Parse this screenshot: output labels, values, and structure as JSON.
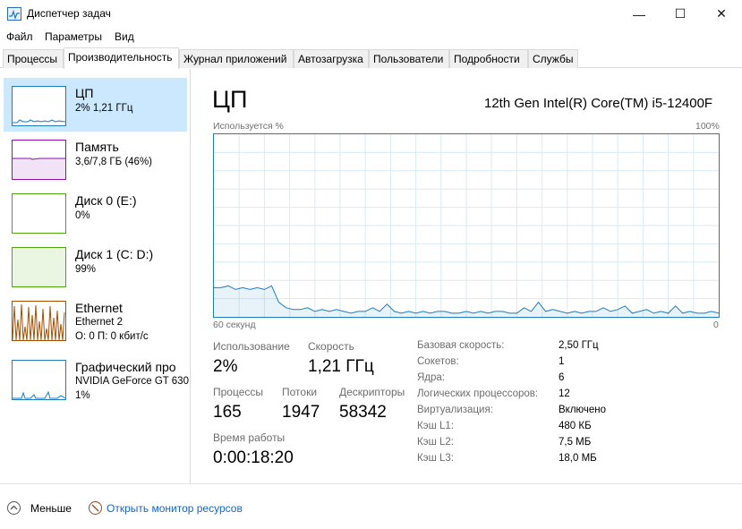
{
  "window": {
    "title": "Диспетчер задач",
    "minimize": "—",
    "maximize": "☐",
    "close": "✕"
  },
  "menu": [
    "Файл",
    "Параметры",
    "Вид"
  ],
  "tabs": [
    "Процессы",
    "Производительность",
    "Журнал приложений",
    "Автозагрузка",
    "Пользователи",
    "Подробности",
    "Службы"
  ],
  "active_tab": 1,
  "resources": [
    {
      "title": "ЦП",
      "sub1": "2% 1,21 ГГц",
      "sub2": "",
      "color": "#1f7bc1"
    },
    {
      "title": "Память",
      "sub1": "3,6/7,8 ГБ (46%)",
      "sub2": "",
      "color": "#8b12ae"
    },
    {
      "title": "Диск 0 (E:)",
      "sub1": "0%",
      "sub2": "",
      "color": "#4da60c"
    },
    {
      "title": "Диск 1 (C: D:)",
      "sub1": "99%",
      "sub2": "",
      "color": "#4da60c"
    },
    {
      "title": "Ethernet",
      "sub1": "Ethernet 2",
      "sub2": "О: 0 П: 0 кбит/с",
      "color": "#a74f01"
    },
    {
      "title": "Графический про",
      "sub1": "NVIDIA GeForce GT 630",
      "sub2": "1%",
      "color": "#1f7bc1"
    }
  ],
  "main": {
    "title": "ЦП",
    "model": "12th Gen Intel(R) Core(TM) i5-12400F",
    "graph_label_left": "Используется %",
    "graph_label_right": "100%",
    "axis_left": "60 секунд",
    "axis_right": "0"
  },
  "stats": {
    "usage_label": "Использование",
    "usage_value": "2%",
    "speed_label": "Скорость",
    "speed_value": "1,21 ГГц",
    "processes_label": "Процессы",
    "processes_value": "165",
    "threads_label": "Потоки",
    "threads_value": "1947",
    "handles_label": "Дескрипторы",
    "handles_value": "58342",
    "uptime_label": "Время работы",
    "uptime_value": "0:00:18:20"
  },
  "info": [
    {
      "label": "Базовая скорость:",
      "value": "2,50 ГГц"
    },
    {
      "label": "Сокетов:",
      "value": "1"
    },
    {
      "label": "Ядра:",
      "value": "6"
    },
    {
      "label": "Логических процессоров:",
      "value": "12"
    },
    {
      "label": "Виртуализация:",
      "value": "Включено"
    },
    {
      "label": "Кэш L1:",
      "value": "480 КБ"
    },
    {
      "label": "Кэш L2:",
      "value": "7,5 МБ"
    },
    {
      "label": "Кэш L3:",
      "value": "18,0 МБ"
    }
  ],
  "cpu_usage_history": [
    16,
    16,
    17,
    15,
    16,
    15,
    16,
    15,
    17,
    8,
    5,
    4,
    4,
    5,
    3,
    4,
    3,
    4,
    3,
    2,
    3,
    3,
    5,
    3,
    7,
    3,
    2,
    3,
    2,
    3,
    2,
    3,
    3,
    2,
    2,
    3,
    2,
    3,
    2,
    3,
    3,
    2,
    2,
    5,
    3,
    8,
    3,
    4,
    3,
    2,
    3,
    2,
    3,
    3,
    5,
    3,
    4,
    6,
    2,
    3,
    4,
    2,
    3,
    2,
    6,
    2,
    3,
    2,
    2,
    3,
    2
  ],
  "footer": {
    "less": "Меньше",
    "monitor": "Открыть монитор ресурсов"
  },
  "colors": {
    "accent": "#1f7bc1",
    "selection": "#cce8ff",
    "link": "#1565c0"
  }
}
